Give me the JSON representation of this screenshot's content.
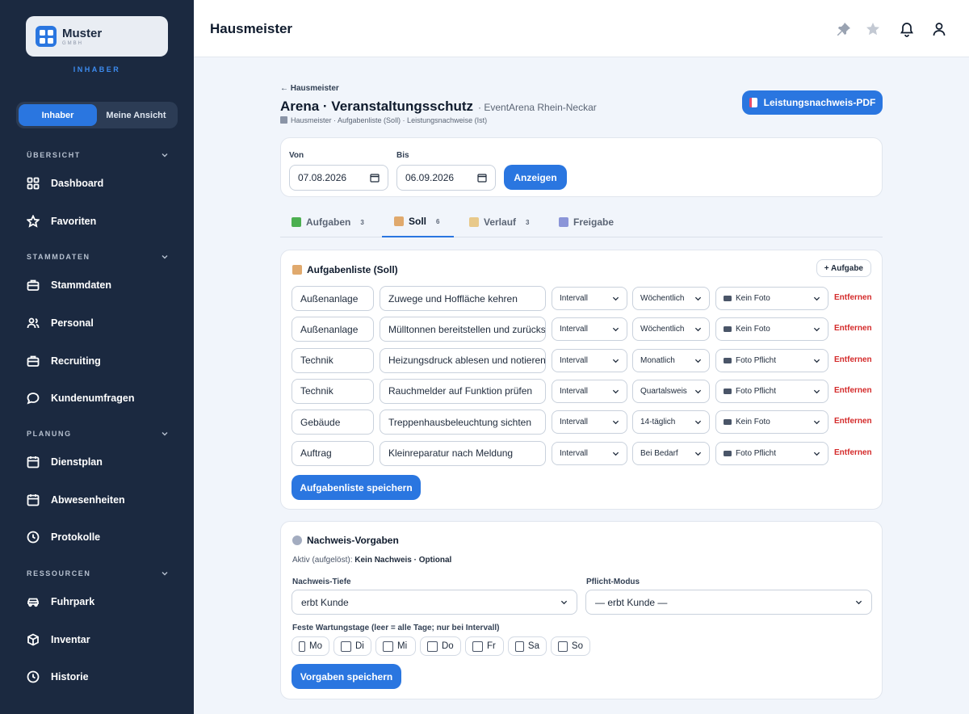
{
  "sidebar": {
    "brand": "Muster",
    "brand_sub": "GMBH",
    "role_label": "INHABER",
    "toggle": [
      "Inhaber",
      "Meine Ansicht"
    ],
    "sections": {
      "overview": "ÜBERSICHT",
      "master": "STAMMDATEN",
      "planning": "PLANUNG",
      "resources": "RESSOURCEN"
    },
    "items": {
      "dashboard": "Dashboard",
      "favorites": "Favoriten",
      "stammdaten": "Stammdaten",
      "personal": "Personal",
      "recruiting": "Recruiting",
      "surveys": "Kundenumfragen",
      "dienstplan": "Dienstplan",
      "absences": "Abwesenheiten",
      "protocols": "Protokolle",
      "fleet": "Fuhrpark",
      "inventory": "Inventar",
      "history": "Historie"
    }
  },
  "header": {
    "title": "Hausmeister"
  },
  "page": {
    "back": "← Hausmeister",
    "title": "Arena · Veranstaltungsschutz",
    "subtitle": "· EventArena Rhein-Neckar",
    "breadcrumb": "Hausmeister · Aufgabenliste (Soll) · Leistungsnachweise (Ist)",
    "pdf_button": "Leistungsnachweis-PDF"
  },
  "filter": {
    "from_label": "Von",
    "from_value": "07.08.2026",
    "to_label": "Bis",
    "to_value": "06.09.2026",
    "show_button": "Anzeigen"
  },
  "tabs": [
    {
      "label": "Aufgaben",
      "count": "3"
    },
    {
      "label": "Soll",
      "count": "6"
    },
    {
      "label": "Verlauf",
      "count": "3"
    },
    {
      "label": "Freigabe",
      "count": ""
    }
  ],
  "tasklist": {
    "title": "Aufgabenliste (Soll)",
    "add_button": "+ Aufgabe",
    "remove_label": "Entfernen",
    "save_button": "Aufgabenliste speichern",
    "rows": [
      {
        "category": "Außenanlage",
        "task": "Zuwege und Hoffläche kehren",
        "mode": "Intervall",
        "interval": "Wöchentlich",
        "photo": "Kein Foto"
      },
      {
        "category": "Außenanlage",
        "task": "Mülltonnen bereitstellen und zurückstellen",
        "mode": "Intervall",
        "interval": "Wöchentlich",
        "photo": "Kein Foto"
      },
      {
        "category": "Technik",
        "task": "Heizungsdruck ablesen und notieren",
        "mode": "Intervall",
        "interval": "Monatlich",
        "photo": "Foto Pflicht"
      },
      {
        "category": "Technik",
        "task": "Rauchmelder auf Funktion prüfen",
        "mode": "Intervall",
        "interval": "Quartalsweise",
        "photo": "Foto Pflicht"
      },
      {
        "category": "Gebäude",
        "task": "Treppenhausbeleuchtung sichten",
        "mode": "Intervall",
        "interval": "14-täglich",
        "photo": "Kein Foto"
      },
      {
        "category": "Auftrag",
        "task": "Kleinreparatur nach Meldung",
        "mode": "Intervall",
        "interval": "Bei Bedarf",
        "photo": "Foto Pflicht"
      }
    ]
  },
  "proof": {
    "title": "Nachweis-Vorgaben",
    "active_prefix": "Aktiv (aufgelöst):",
    "active_value": "Kein Nachweis · Optional",
    "depth_label": "Nachweis-Tiefe",
    "depth_value": "erbt Kunde",
    "mode_label": "Pflicht-Modus",
    "mode_value": "— erbt Kunde —",
    "days_label": "Feste Wartungstage (leer = alle Tage; nur bei Intervall)",
    "days": [
      "Mo",
      "Di",
      "Mi",
      "Do",
      "Fr",
      "Sa",
      "So"
    ],
    "save_button": "Vorgaben speichern"
  }
}
